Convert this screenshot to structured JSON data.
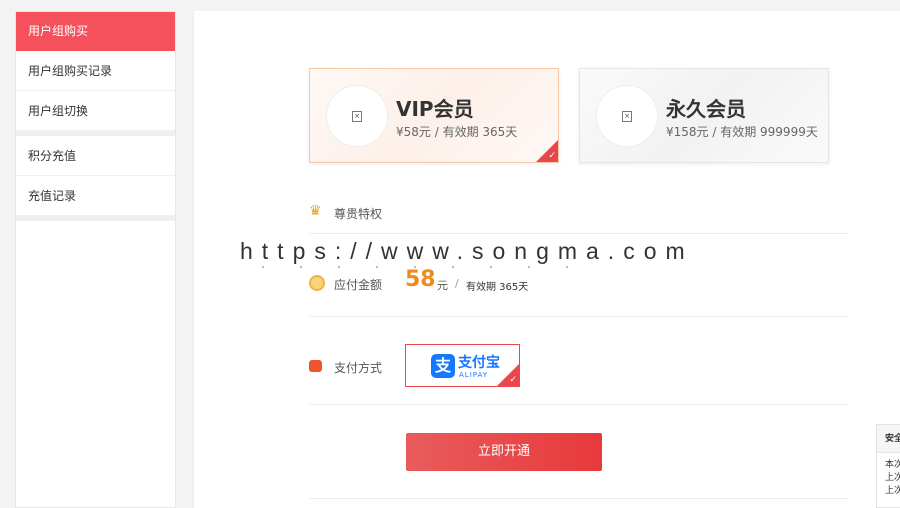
{
  "sidebar": {
    "group1": [
      {
        "label": "用户组购买",
        "active": true
      },
      {
        "label": "用户组购买记录"
      },
      {
        "label": "用户组切换"
      }
    ],
    "group2": [
      {
        "label": "积分充值"
      },
      {
        "label": "充值记录"
      }
    ]
  },
  "plans": [
    {
      "name": "VIP会员",
      "desc": "¥58元 / 有效期 365天",
      "selected": true
    },
    {
      "name": "永久会员",
      "desc": "¥158元 / 有效期 999999天",
      "selected": false
    }
  ],
  "privilege": {
    "label": "尊贵特权"
  },
  "amount": {
    "label": "应付金额",
    "value": "58",
    "unit": "元",
    "sep": "/",
    "validity": "有效期 365天"
  },
  "payment": {
    "label": "支付方式",
    "method_cn": "支付宝",
    "method_en": "ALIPAY",
    "logo_glyph": "支"
  },
  "submit": {
    "label": "立即开通"
  },
  "watermark": {
    "text": "https://www.songma.com"
  },
  "safety": {
    "title": "安全",
    "lines": [
      "本次",
      "上次",
      "上次"
    ]
  },
  "icons": {
    "check": "✓",
    "broken_image": "×"
  },
  "colors": {
    "accent": "#f5515c",
    "price": "#f08a1e",
    "alipay": "#1677ff"
  }
}
